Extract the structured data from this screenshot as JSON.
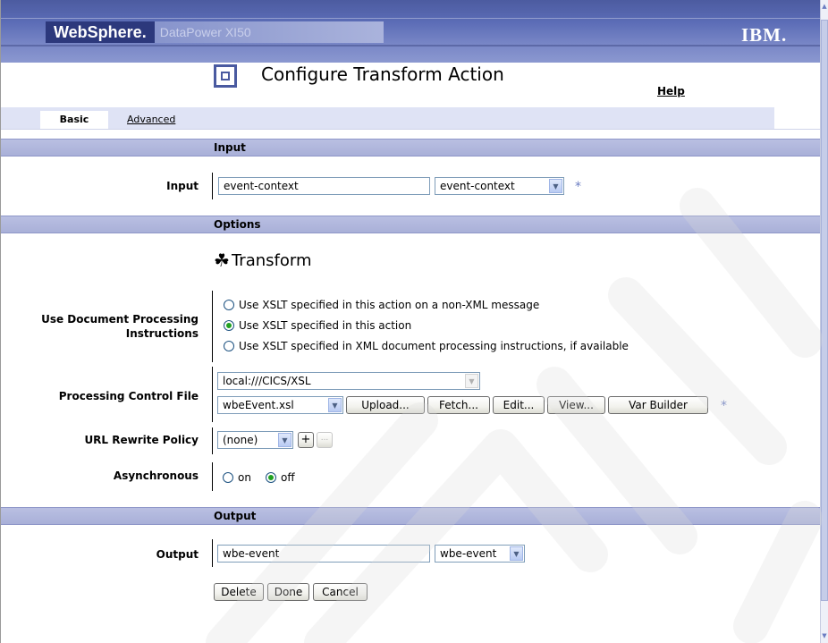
{
  "banner": {
    "brand_main": "WebSphere.",
    "brand_product": "DataPower XI50",
    "vendor": "IBM."
  },
  "header": {
    "title": "Configure Transform Action",
    "help": "Help"
  },
  "tabs": [
    {
      "label": "Basic",
      "active": true
    },
    {
      "label": "Advanced",
      "active": false
    }
  ],
  "input_section": {
    "heading": "Input",
    "label": "Input",
    "value": "event-context",
    "select_value": "event-context",
    "required": "*"
  },
  "options_section": {
    "heading": "Options",
    "subheading": "Transform",
    "use_doc_label_line1": "Use Document Processing",
    "use_doc_label_line2": "Instructions",
    "radio_options": [
      {
        "label": "Use XSLT specified in this action on a non-XML message",
        "selected": false
      },
      {
        "label": "Use XSLT specified in this action",
        "selected": true
      },
      {
        "label": "Use XSLT specified in XML document processing instructions, if available",
        "selected": false
      }
    ],
    "processing_control_label": "Processing Control File",
    "path_value": "local:///CICS/XSL",
    "file_value": "wbeEvent.xsl",
    "buttons": {
      "upload": "Upload...",
      "fetch": "Fetch...",
      "edit": "Edit...",
      "view": "View...",
      "var_builder": "Var Builder"
    },
    "required": "*",
    "url_rewrite_label": "URL Rewrite Policy",
    "url_rewrite_value": "(none)",
    "add_symbol": "+",
    "more_symbol": "...",
    "async_label": "Asynchronous",
    "async_on": "on",
    "async_off": "off",
    "async_selected": "off"
  },
  "output_section": {
    "heading": "Output",
    "label": "Output",
    "value": "wbe-event",
    "select_value": "wbe-event"
  },
  "actions": {
    "delete": "Delete",
    "done": "Done",
    "cancel": "Cancel"
  },
  "colors": {
    "banner": "#5b6cb6",
    "section": "#b1b8de",
    "tabbar": "#dfe3f5",
    "accent_star": "#6b7dc2"
  }
}
